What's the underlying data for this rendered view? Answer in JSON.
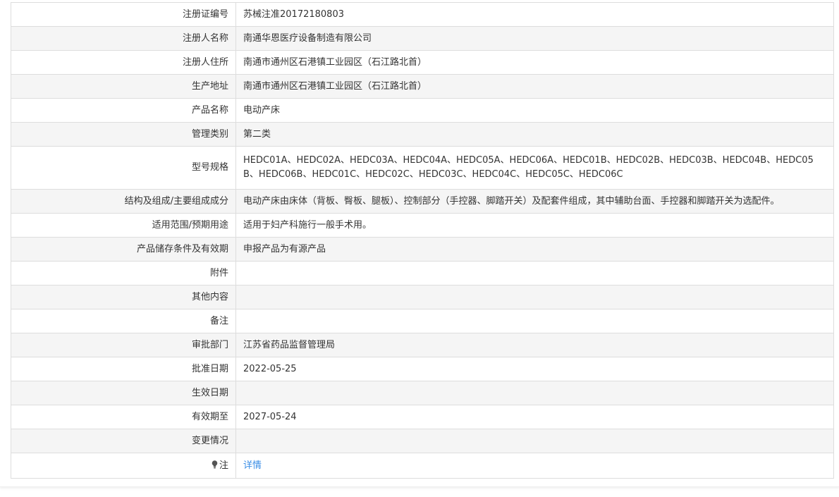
{
  "rows": [
    {
      "label": "注册证编号",
      "value": "苏械注准20172180803"
    },
    {
      "label": "注册人名称",
      "value": "南通华恩医疗设备制造有限公司"
    },
    {
      "label": "注册人住所",
      "value": "南通市通州区石港镇工业园区（石江路北首）"
    },
    {
      "label": "生产地址",
      "value": "南通市通州区石港镇工业园区（石江路北首）"
    },
    {
      "label": "产品名称",
      "value": "电动产床"
    },
    {
      "label": "管理类别",
      "value": "第二类"
    },
    {
      "label": "型号规格",
      "value": "HEDC01A、HEDC02A、HEDC03A、HEDC04A、HEDC05A、HEDC06A、HEDC01B、HEDC02B、HEDC03B、HEDC04B、HEDC05B、HEDC06B、HEDC01C、HEDC02C、HEDC03C、HEDC04C、HEDC05C、HEDC06C"
    },
    {
      "label": "结构及组成/主要组成成分",
      "value": "电动产床由床体（背板、臀板、腿板）、控制部分（手控器、脚踏开关）及配套件组成，其中辅助台面、手控器和脚踏开关为选配件。"
    },
    {
      "label": "适用范围/预期用途",
      "value": "适用于妇产科施行一般手术用。"
    },
    {
      "label": "产品储存条件及有效期",
      "value": "申报产品为有源产品"
    },
    {
      "label": "附件",
      "value": ""
    },
    {
      "label": "其他内容",
      "value": ""
    },
    {
      "label": "备注",
      "value": ""
    },
    {
      "label": "审批部门",
      "value": "江苏省药品监督管理局"
    },
    {
      "label": "批准日期",
      "value": "2022-05-25"
    },
    {
      "label": "生效日期",
      "value": ""
    },
    {
      "label": "有效期至",
      "value": "2027-05-24"
    },
    {
      "label": "变更情况",
      "value": ""
    }
  ],
  "note": {
    "icon": "bulb-icon",
    "label": "注",
    "link_text": "详情"
  },
  "colors": {
    "link": "#3a8ee6",
    "alt_row_bg": "#f5f5f5",
    "border": "#dddddd"
  }
}
